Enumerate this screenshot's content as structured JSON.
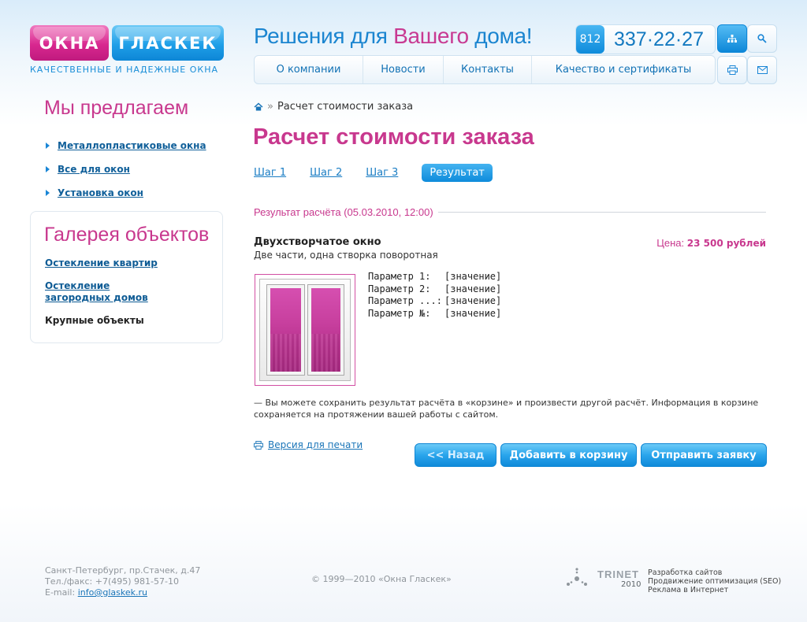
{
  "header": {
    "logo_left": "ОКНА",
    "logo_right": "ГЛАСКЕК",
    "tagline": "КАЧЕСТВЕННЫЕ И НАДЕЖНЫЕ ОКНА",
    "slogan_start": "Решения для ",
    "slogan_accent": "Вашего",
    "slogan_end": " дома!",
    "phone_code": "812",
    "phone_number": "337·22·27",
    "nav": [
      "О компании",
      "Новости",
      "Контакты",
      "Качество и сертификаты"
    ],
    "icons": [
      "sitemap-icon",
      "search-icon",
      "print-icon",
      "mail-icon"
    ]
  },
  "sidebar": {
    "offer_title": "Мы предлагаем",
    "offer_items": [
      "Металлопластиковые окна",
      "Все для окон",
      "Установка окон"
    ],
    "gallery_title": "Галерея объектов",
    "gallery_items": [
      "Остекление квартир",
      "Остекление загородных домов",
      "Крупные объекты"
    ],
    "gallery_item2_line1": "Остекление",
    "gallery_item2_line2": "загородных домов"
  },
  "main": {
    "breadcrumb_current": "Расчет стоимости заказа",
    "title": "Расчет стоимости заказа",
    "steps": [
      "Шаг 1",
      "Шаг 2",
      "Шаг 3"
    ],
    "step_active": "Результат",
    "result_heading": "Результат расчёта (05.03.2010, 12:00)",
    "product_name": "Двухстворчатое окно",
    "product_desc": "Две части, одна створка поворотная",
    "price_label": "Цена: ",
    "price_value": "23 500 рублей",
    "params": [
      {
        "name": "Параметр 1:",
        "value": "[значение]"
      },
      {
        "name": "Параметр 2:",
        "value": "[значение]"
      },
      {
        "name": "Параметр ...:",
        "value": "[значение]"
      },
      {
        "name": "Параметр №:",
        "value": "[значение]"
      }
    ],
    "note": "— Вы можете сохранить результат расчёта в «корзине» и произвести другой расчёт. Информация в корзине сохраняется на протяжении вашей работы с сайтом.",
    "print_version": "Версия для печати",
    "btn_back": "<< Назад",
    "btn_cart": "Добавить в корзину",
    "btn_send": "Отправить заявку"
  },
  "footer": {
    "address": "Санкт-Петербург, пр.Стачек, д.47",
    "phone": "Тел./факс: +7(495) 981-57-10",
    "email_label": "E-mail: ",
    "email": "info@glaskek.ru",
    "copyright": "© 1999—2010 «Окна Гласкек»",
    "dev_name": "TRINET",
    "dev_year": "2010",
    "dev_links": [
      "Разработка сайтов",
      "Продвижение оптимизация (SEO)",
      "Реклама в Интернет"
    ]
  },
  "colors": {
    "brand_pink": "#c8388e",
    "brand_blue": "#1b85d0"
  }
}
